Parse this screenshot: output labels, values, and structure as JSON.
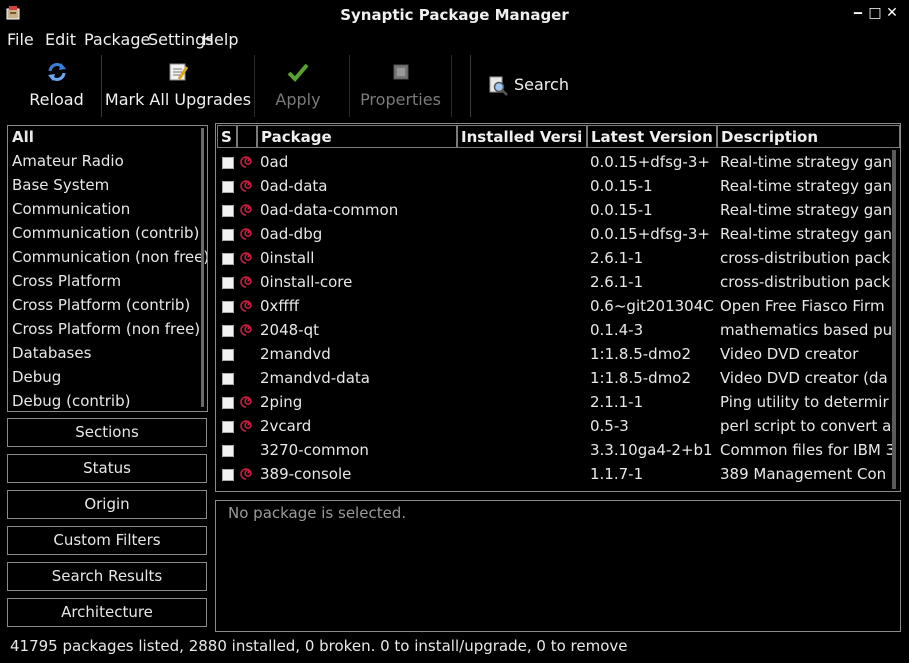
{
  "window": {
    "title": "Synaptic Package Manager"
  },
  "menu": [
    "File",
    "Edit",
    "Package",
    "Settings",
    "Help"
  ],
  "toolbar": {
    "reload": "Reload",
    "mark_all": "Mark All Upgrades",
    "apply": "Apply",
    "properties": "Properties",
    "search": "Search"
  },
  "categories": [
    "All",
    "Amateur Radio",
    "Base System",
    "Communication",
    "Communication (contrib)",
    "Communication (non free)",
    "Cross Platform",
    "Cross Platform (contrib)",
    "Cross Platform (non free)",
    "Databases",
    "Debug",
    "Debug (contrib)"
  ],
  "filters": [
    "Sections",
    "Status",
    "Origin",
    "Custom Filters",
    "Search Results",
    "Architecture"
  ],
  "table": {
    "headers": {
      "s": "S",
      "package": "Package",
      "installed": "Installed Versi",
      "latest": "Latest Version",
      "description": "Description"
    },
    "rows": [
      {
        "name": "0ad",
        "latest": "0.0.15+dfsg-3+",
        "desc": "Real-time strategy gan",
        "debian": true
      },
      {
        "name": "0ad-data",
        "latest": "0.0.15-1",
        "desc": "Real-time strategy gan",
        "debian": true
      },
      {
        "name": "0ad-data-common",
        "latest": "0.0.15-1",
        "desc": "Real-time strategy gan",
        "debian": true
      },
      {
        "name": "0ad-dbg",
        "latest": "0.0.15+dfsg-3+",
        "desc": "Real-time strategy gan",
        "debian": true
      },
      {
        "name": "0install",
        "latest": "2.6.1-1",
        "desc": "cross-distribution pack",
        "debian": true
      },
      {
        "name": "0install-core",
        "latest": "2.6.1-1",
        "desc": "cross-distribution pack",
        "debian": true
      },
      {
        "name": "0xffff",
        "latest": "0.6~git201304C",
        "desc": "Open Free Fiasco Firm ",
        "debian": true
      },
      {
        "name": "2048-qt",
        "latest": "0.1.4-3",
        "desc": "mathematics based pu",
        "debian": true
      },
      {
        "name": "2mandvd",
        "latest": "1:1.8.5-dmo2",
        "desc": "Video DVD creator",
        "debian": false
      },
      {
        "name": "2mandvd-data",
        "latest": "1:1.8.5-dmo2",
        "desc": "Video DVD creator (da",
        "debian": false
      },
      {
        "name": "2ping",
        "latest": "2.1.1-1",
        "desc": "Ping utility to determir",
        "debian": true
      },
      {
        "name": "2vcard",
        "latest": "0.5-3",
        "desc": "perl script to convert a",
        "debian": true
      },
      {
        "name": "3270-common",
        "latest": "3.3.10ga4-2+b1",
        "desc": "Common files for IBM 3",
        "debian": false
      },
      {
        "name": "389-console",
        "latest": "1.1.7-1",
        "desc": "389 Management Con",
        "debian": true
      }
    ]
  },
  "description_panel": "No package is selected.",
  "status": "41795 packages listed, 2880 installed, 0 broken. 0 to install/upgrade, 0 to remove",
  "colors": {
    "debian_swirl": "#c81e3c",
    "apply_check": "#5aa02c",
    "reload_blue": "#3a7fd5"
  }
}
